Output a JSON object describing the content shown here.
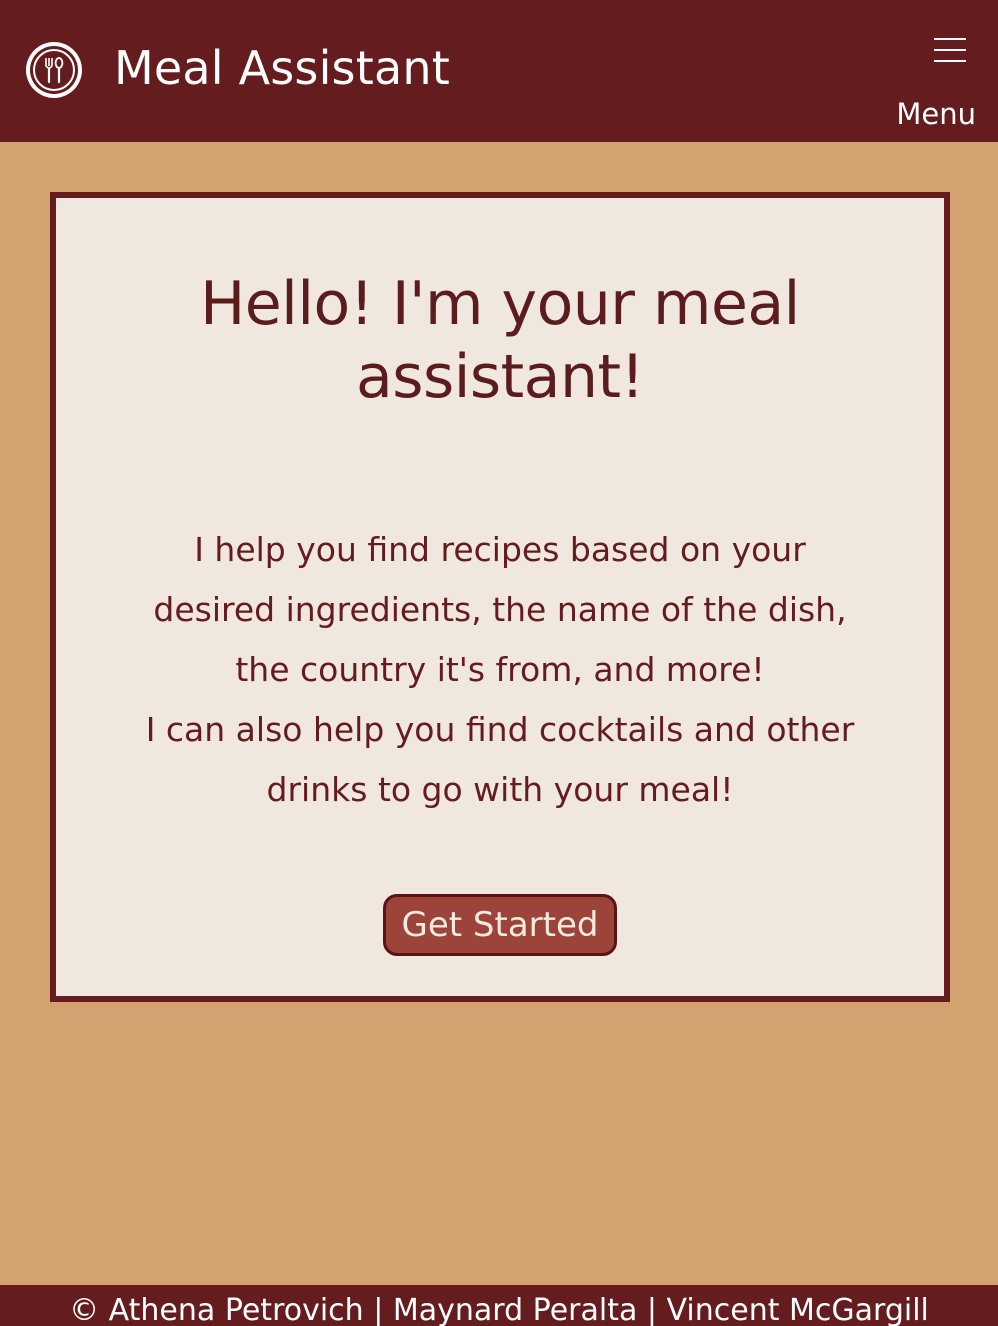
{
  "header": {
    "app_title": "Meal Assistant",
    "logo_icon": "plate-fork-spoon-icon",
    "menu_icon": "hamburger-menu-icon",
    "menu_label": "Menu"
  },
  "card": {
    "title": "Hello! I'm your meal assistant!",
    "description_lines": [
      "I help you find recipes based on your",
      "desired ingredients, the name of the dish,",
      "the country it's from, and more!",
      "I can also help you find cocktails and other",
      "drinks to go with your meal!"
    ],
    "cta_label": "Get Started"
  },
  "footer": {
    "credits": "© Athena Petrovich | Maynard Peralta | Vincent McGargill"
  },
  "colors": {
    "header_bg": "#641c1e",
    "page_bg": "#d3a271",
    "card_bg": "#f0e7de",
    "button_bg": "#9c443a",
    "text_dark": "#641c1e"
  }
}
